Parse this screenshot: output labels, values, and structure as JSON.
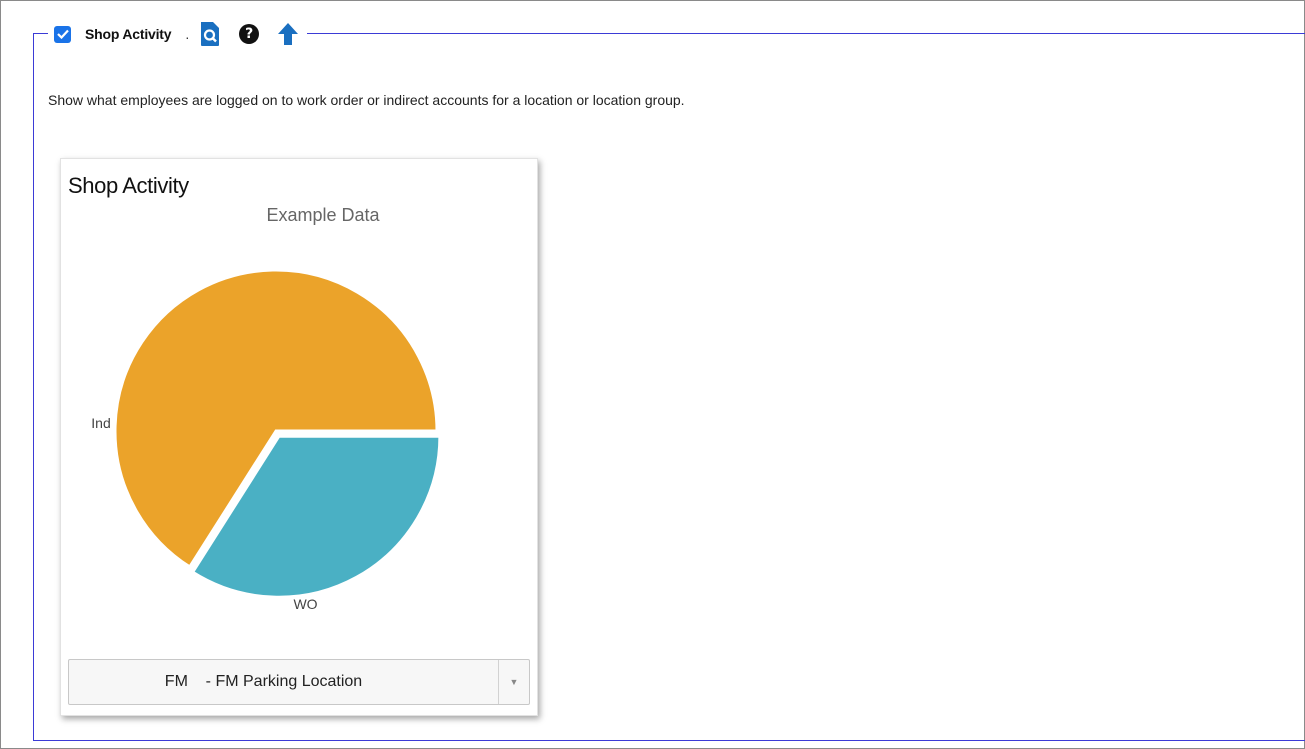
{
  "widget": {
    "title": "Shop Activity",
    "separator": ".",
    "checked": true,
    "description": "Show what employees are logged on to work order or indirect accounts for a location or location group.",
    "icons": [
      "preview-icon",
      "help-icon",
      "move-up-icon"
    ],
    "accent_color": "#1a73e8",
    "border_color": "#3b3bd6"
  },
  "card": {
    "title": "Shop Activity",
    "subtitle": "Example Data",
    "location_select": {
      "value": "FM    - FM Parking Location"
    }
  },
  "chart_data": {
    "type": "pie",
    "title": "Shop Activity",
    "subtitle": "Example Data",
    "slices": [
      {
        "label": "Ind",
        "value": 66,
        "color": "#eba32a"
      },
      {
        "label": "WO",
        "value": 34,
        "color": "#4ab0c4"
      }
    ]
  }
}
